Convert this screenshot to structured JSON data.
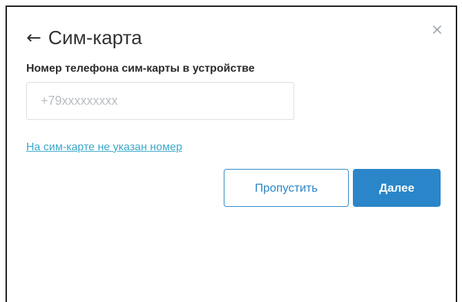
{
  "dialog": {
    "back_arrow": "←",
    "title": "Сим-карта",
    "close_icon": "close-icon"
  },
  "form": {
    "phone_label": "Номер телефона сим-карты в устройстве",
    "phone_value": "",
    "phone_placeholder": "+79xxxxxxxxx",
    "no_number_link": "На сим-карте не указан номер"
  },
  "actions": {
    "skip_label": "Пропустить",
    "next_label": "Далее"
  },
  "colors": {
    "accent": "#2a86c8",
    "link": "#3aa7c9",
    "text": "#333333"
  }
}
